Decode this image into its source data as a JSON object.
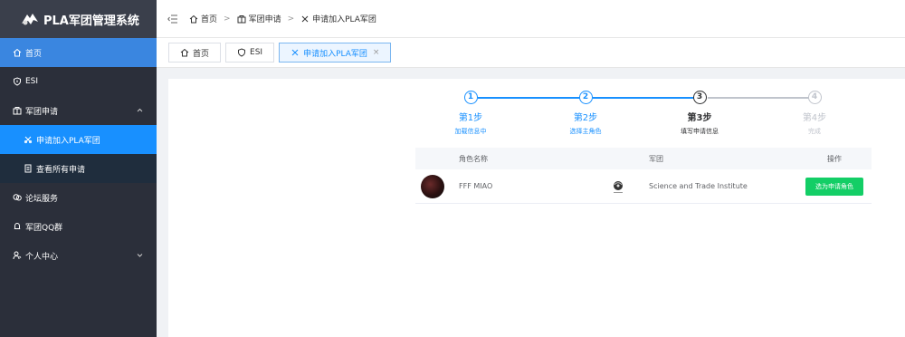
{
  "app": {
    "title": "PLA军团管理系统"
  },
  "sidebar": {
    "items": [
      {
        "label": "首页",
        "icon": "home-icon"
      },
      {
        "label": "ESI",
        "icon": "shield-icon"
      },
      {
        "label": "军团申请",
        "icon": "group-icon"
      },
      {
        "label": "论坛服务",
        "icon": "chat-icon"
      },
      {
        "label": "军团QQ群",
        "icon": "bell-icon"
      },
      {
        "label": "个人中心",
        "icon": "user-icon"
      }
    ],
    "sub_items": [
      {
        "label": "申请加入PLA军团",
        "icon": "join-icon"
      },
      {
        "label": "查看所有申请",
        "icon": "document-icon"
      }
    ]
  },
  "breadcrumb": [
    "首页",
    "军团申请",
    "申请加入PLA军团"
  ],
  "tabs": [
    {
      "label": "首页"
    },
    {
      "label": "ESI"
    },
    {
      "label": "申请加入PLA军团"
    }
  ],
  "steps": [
    {
      "num": "1",
      "title": "第1步",
      "desc": "加载信息中",
      "status": "done"
    },
    {
      "num": "2",
      "title": "第2步",
      "desc": "选择主角色",
      "status": "done"
    },
    {
      "num": "3",
      "title": "第3步",
      "desc": "填写申请信息",
      "status": "current"
    },
    {
      "num": "4",
      "title": "第4步",
      "desc": "完成",
      "status": "wait"
    }
  ],
  "table": {
    "headers": [
      "角色名称",
      "军团",
      "操作"
    ],
    "rows": [
      {
        "name": "FFF MIAO",
        "corp": "Science and Trade Institute",
        "action": "选为申请角色"
      }
    ]
  },
  "colors": {
    "primary": "#1890ff",
    "success": "#13ce66",
    "sidebar": "#2b2f3a"
  }
}
